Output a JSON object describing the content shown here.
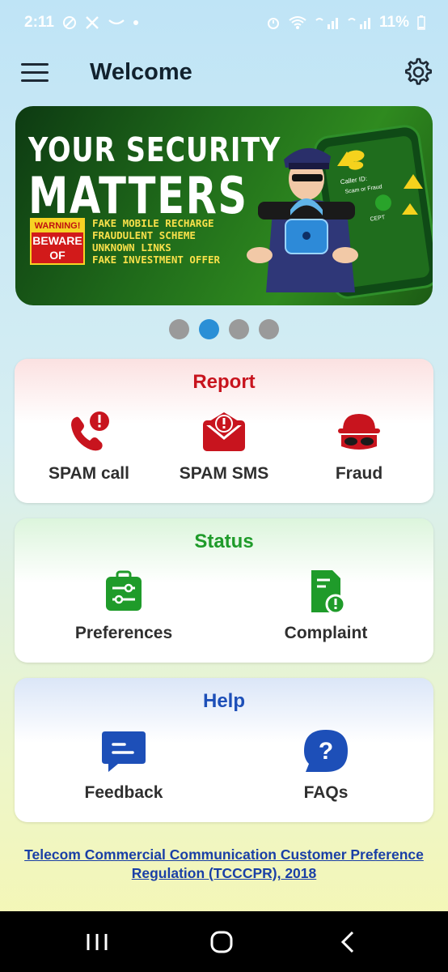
{
  "status_bar": {
    "time": "2:11",
    "battery": "11%"
  },
  "header": {
    "title": "Welcome",
    "menu_icon": "hamburger-menu-icon",
    "settings_icon": "gear-icon"
  },
  "banner": {
    "line1": "YOUR SECURITY",
    "line2": "MATTERS",
    "warning_top": "WARNING!",
    "warning_mid1": "BEWARE",
    "warning_mid2": "OF",
    "items": [
      "FAKE MOBILE RECHARGE",
      "FRAUDULENT SCHEME",
      "UNKNOWN LINKS",
      "FAKE INVESTMENT OFFER"
    ],
    "phone_caller_id": "Caller ID:",
    "phone_scam": "Scam or Fraud",
    "phone_accept": "CEPT"
  },
  "carousel": {
    "count": 4,
    "active_index": 1
  },
  "report": {
    "title": "Report",
    "title_color": "#c8141e",
    "items": [
      {
        "label": "SPAM call",
        "icon": "phone-alert-icon"
      },
      {
        "label": "SPAM SMS",
        "icon": "envelope-alert-icon"
      },
      {
        "label": "Fraud",
        "icon": "masked-thief-icon"
      }
    ]
  },
  "status": {
    "title": "Status",
    "title_color": "#1f9b2a",
    "items": [
      {
        "label": "Preferences",
        "icon": "preferences-sliders-icon"
      },
      {
        "label": "Complaint",
        "icon": "complaint-document-icon"
      }
    ]
  },
  "help": {
    "title": "Help",
    "title_color": "#1d4fb8",
    "items": [
      {
        "label": "Feedback",
        "icon": "chat-bubble-icon"
      },
      {
        "label": "FAQs",
        "icon": "question-bubble-icon"
      }
    ]
  },
  "footer": {
    "link_line1": "Telecom Commercial Communication Customer Preference",
    "link_line2": "Regulation (TCCCPR), 2018"
  }
}
